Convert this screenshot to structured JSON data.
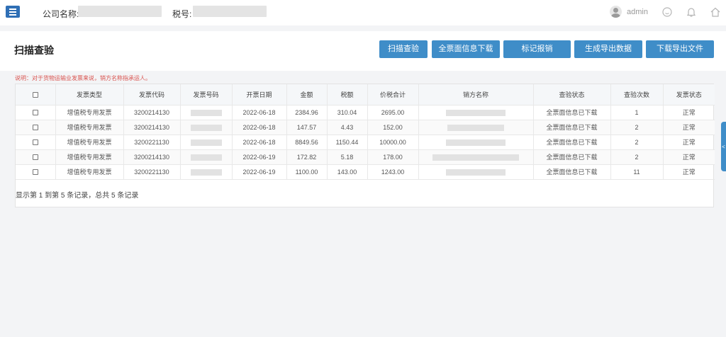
{
  "topbar": {
    "company_label": "公司名称:",
    "tax_label": "税号:",
    "username": "admin",
    "icons": [
      "user-avatar",
      "chat-icon",
      "bell-icon",
      "home-icon"
    ]
  },
  "page": {
    "title": "扫描查验",
    "buttons": [
      "扫描查验",
      "全票面信息下载",
      "标记报销",
      "生成导出数据",
      "下载导出文件"
    ],
    "note": "说明：对于货物运输业发票来说，销方名称指承运人。"
  },
  "colors": {
    "accent": "#3f8dc8",
    "menu": "#2f6fb5",
    "note": "#d9534f"
  },
  "table": {
    "headers": [
      "",
      "发票类型",
      "发票代码",
      "发票号码",
      "开票日期",
      "金额",
      "税额",
      "价税合计",
      "销方名称",
      "查验状态",
      "查验次数",
      "发票状态"
    ],
    "rows": [
      {
        "type": "增值税专用发票",
        "code": "3200214130",
        "date": "2022-06-18",
        "amount": "2384.96",
        "tax": "310.04",
        "total": "2695.00",
        "status": "全票面信息已下载",
        "count": "1",
        "invoice_status": "正常"
      },
      {
        "type": "增值税专用发票",
        "code": "3200214130",
        "date": "2022-06-18",
        "amount": "147.57",
        "tax": "4.43",
        "total": "152.00",
        "status": "全票面信息已下载",
        "count": "2",
        "invoice_status": "正常"
      },
      {
        "type": "增值税专用发票",
        "code": "3200221130",
        "date": "2022-06-18",
        "amount": "8849.56",
        "tax": "1150.44",
        "total": "10000.00",
        "status": "全票面信息已下载",
        "count": "2",
        "invoice_status": "正常"
      },
      {
        "type": "增值税专用发票",
        "code": "3200214130",
        "date": "2022-06-19",
        "amount": "172.82",
        "tax": "5.18",
        "total": "178.00",
        "status": "全票面信息已下载",
        "count": "2",
        "invoice_status": "正常"
      },
      {
        "type": "增值税专用发票",
        "code": "3200221130",
        "date": "2022-06-19",
        "amount": "1100.00",
        "tax": "143.00",
        "total": "1243.00",
        "status": "全票面信息已下载",
        "count": "11",
        "invoice_status": "正常"
      }
    ],
    "pagination": "显示第 1 到第 5 条记录，总共 5 条记录"
  },
  "side_handle": "<"
}
